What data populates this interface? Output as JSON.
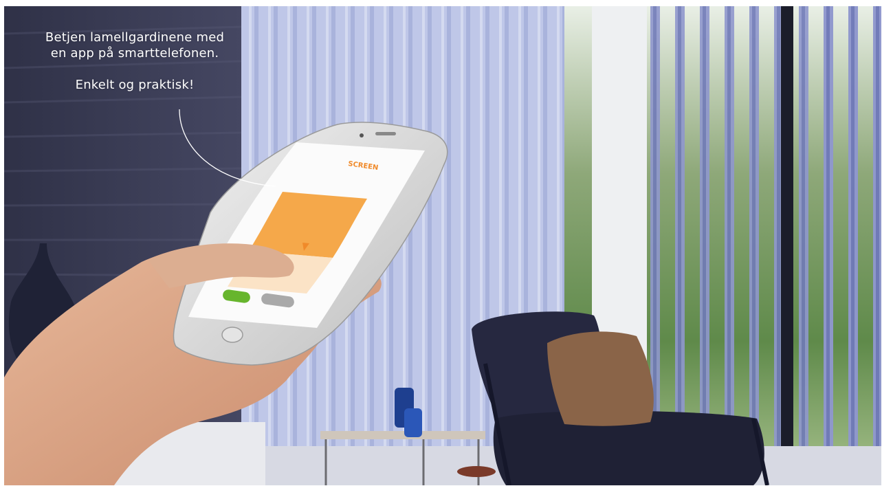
{
  "caption": {
    "line1": "Betjen lamellgardinene med",
    "line2": "en app på smarttelefonen.",
    "line3": "Enkelt og praktisk!"
  },
  "phone": {
    "logo_text": "SCREEN",
    "ok_button_label": "",
    "cancel_button_label": ""
  },
  "colors": {
    "blind": "#bcc5e6",
    "wall": "#37384f",
    "app_orange": "#f5a84a",
    "ok_green": "#67b52d",
    "chair": "#23253a",
    "pillow": "#8a6448"
  }
}
